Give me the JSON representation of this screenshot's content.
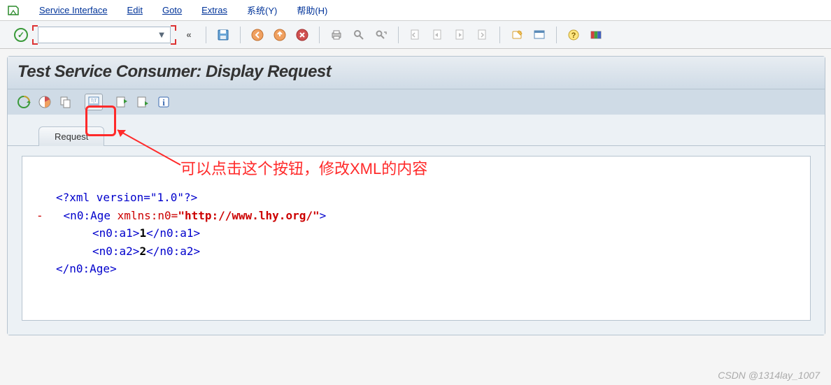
{
  "menu": {
    "items": [
      "Service Interface",
      "Edit",
      "Goto",
      "Extras",
      "系统(Y)",
      "帮助(H)"
    ]
  },
  "toolbar": {
    "command_value": "",
    "command_placeholder": "",
    "buttons": {
      "ok": "✓",
      "back": "«",
      "save": "save",
      "back2": "back",
      "exit": "exit",
      "cancel": "cancel",
      "print": "print",
      "find": "find",
      "find_next": "find-next",
      "first": "first",
      "prev": "prev",
      "next": "next",
      "last": "last",
      "new_session": "new-session",
      "layout": "layout",
      "help": "help",
      "color": "color-legend"
    }
  },
  "page": {
    "title": "Test Service Consumer: Display Request"
  },
  "sub_toolbar": {
    "buttons": [
      {
        "name": "execute",
        "title": "Execute"
      },
      {
        "name": "pie",
        "title": "Analyze"
      },
      {
        "name": "copy",
        "title": "Copy"
      },
      {
        "name": "xml-editor",
        "title": "XML Editor"
      },
      {
        "name": "import",
        "title": "Import"
      },
      {
        "name": "export",
        "title": "Export"
      },
      {
        "name": "info",
        "title": "Information"
      }
    ]
  },
  "tabs": [
    {
      "label": "Request",
      "active": true
    }
  ],
  "xml": {
    "decl": "<?xml version=\"1.0\"?>",
    "root_open_pre": "<n0:Age ",
    "root_attr_name": "xmlns:n0=",
    "root_attr_val": "\"http://www.lhy.org/\"",
    "root_open_post": ">",
    "a1_open": "<n0:a1>",
    "a1_val": "1",
    "a1_close": "</n0:a1>",
    "a2_open": "<n0:a2>",
    "a2_val": "2",
    "a2_close": "</n0:a2>",
    "root_close": "</n0:Age>",
    "collapse": "-"
  },
  "annotation": {
    "text": "可以点击这个按钮，修改XML的内容"
  },
  "watermark": "CSDN @1314lay_1007"
}
